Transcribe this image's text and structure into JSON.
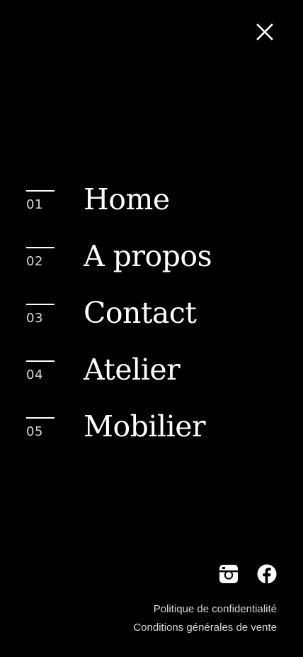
{
  "close": {
    "icon": "close-icon"
  },
  "menu": {
    "items": [
      {
        "num": "01",
        "label": "Home"
      },
      {
        "num": "02",
        "label": "A propos"
      },
      {
        "num": "03",
        "label": "Contact"
      },
      {
        "num": "04",
        "label": "Atelier"
      },
      {
        "num": "05",
        "label": "Mobilier"
      }
    ]
  },
  "social": {
    "icons": [
      "instagram-icon",
      "facebook-icon"
    ]
  },
  "footer": {
    "privacy": "Politique de confidentialité",
    "terms": "Conditions générales de vente"
  },
  "colors": {
    "background": "#000000",
    "text": "#ffffff",
    "muted": "#d9d9d9"
  }
}
